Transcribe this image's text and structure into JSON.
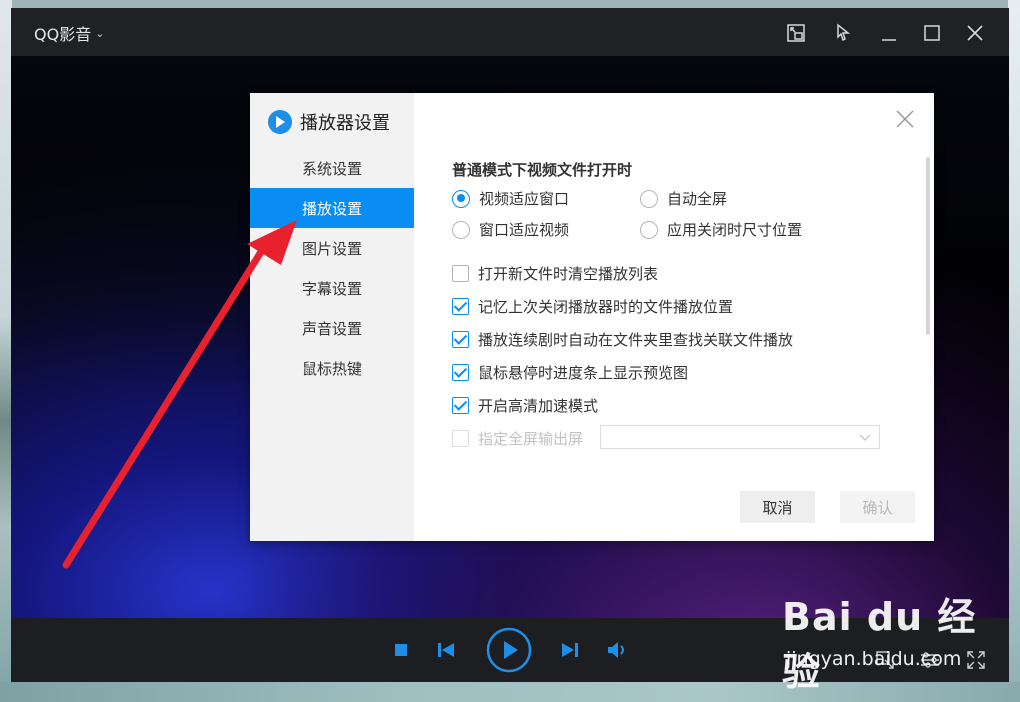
{
  "app": {
    "title": "QQ影音",
    "dropdown_glyph": "⌄"
  },
  "window_controls": [
    "miniplayer-icon",
    "pin-icon",
    "minimize-icon",
    "maximize-icon",
    "close-icon"
  ],
  "dialog": {
    "title": "播放器设置",
    "nav": [
      {
        "label": "系统设置",
        "active": false
      },
      {
        "label": "播放设置",
        "active": true
      },
      {
        "label": "图片设置",
        "active": false
      },
      {
        "label": "字幕设置",
        "active": false
      },
      {
        "label": "声音设置",
        "active": false
      },
      {
        "label": "鼠标热键",
        "active": false
      }
    ],
    "section_title": "普通模式下视频文件打开时",
    "radios": [
      {
        "label": "视频适应窗口",
        "checked": true
      },
      {
        "label": "自动全屏",
        "checked": false
      },
      {
        "label": "窗口适应视频",
        "checked": false
      },
      {
        "label": "应用关闭时尺寸位置",
        "checked": false
      }
    ],
    "checkboxes": [
      {
        "label": "打开新文件时清空播放列表",
        "checked": false,
        "disabled": false
      },
      {
        "label": "记忆上次关闭播放器时的文件播放位置",
        "checked": true,
        "disabled": false
      },
      {
        "label": "播放连续剧时自动在文件夹里查找关联文件播放",
        "checked": true,
        "disabled": false
      },
      {
        "label": "鼠标悬停时进度条上显示预览图",
        "checked": true,
        "disabled": false
      },
      {
        "label": "开启高清加速模式",
        "checked": true,
        "disabled": false
      },
      {
        "label": "指定全屏输出屏",
        "checked": false,
        "disabled": true
      }
    ],
    "screen_select_value": "",
    "buttons": {
      "cancel": "取消",
      "ok": "确认"
    }
  },
  "player_controls": [
    "stop-icon",
    "previous-icon",
    "play-icon",
    "next-icon",
    "volume-icon",
    "screenshot-icon",
    "settings-icon",
    "fullscreen-icon"
  ],
  "colors": {
    "accent": "#0a8df2",
    "titlebar": "#202124",
    "controlbar": "#1d1e21",
    "annotation_arrow": "#e8212e"
  },
  "watermark": {
    "brand": "Bai du 经验",
    "url": "jingyan.baidu.com"
  }
}
